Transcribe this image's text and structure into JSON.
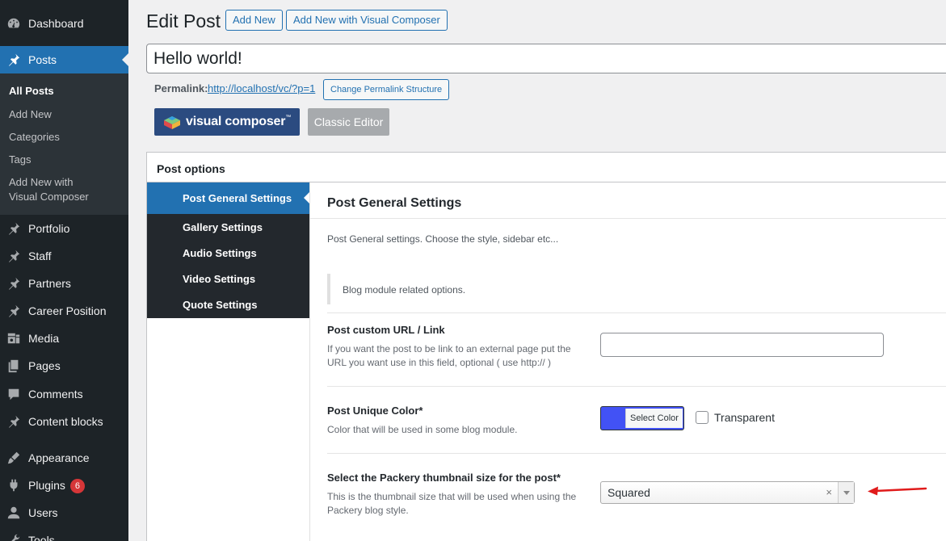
{
  "sidebar": {
    "items": [
      {
        "label": "Dashboard",
        "icon": "dashboard-icon"
      },
      {
        "label": "Posts",
        "icon": "pushpin-icon"
      },
      {
        "label": "Portfolio",
        "icon": "pushpin-icon"
      },
      {
        "label": "Staff",
        "icon": "pushpin-icon"
      },
      {
        "label": "Partners",
        "icon": "pushpin-icon"
      },
      {
        "label": "Career Position",
        "icon": "pushpin-icon"
      },
      {
        "label": "Media",
        "icon": "media-icon"
      },
      {
        "label": "Pages",
        "icon": "pages-icon"
      },
      {
        "label": "Comments",
        "icon": "comments-icon"
      },
      {
        "label": "Content blocks",
        "icon": "pushpin-icon"
      },
      {
        "label": "Appearance",
        "icon": "appearance-icon"
      },
      {
        "label": "Plugins",
        "icon": "plugins-icon",
        "badge": "6"
      },
      {
        "label": "Users",
        "icon": "users-icon"
      },
      {
        "label": "Tools",
        "icon": "tools-icon"
      }
    ],
    "posts_submenu": [
      "All Posts",
      "Add New",
      "Categories",
      "Tags",
      "Add New with\nVisual Composer"
    ],
    "current_item": "Posts",
    "current_subitem": "All Posts"
  },
  "header": {
    "title": "Edit Post",
    "add_new_label": "Add New",
    "add_new_vc_label": "Add New with Visual Composer"
  },
  "post": {
    "title": "Hello world!"
  },
  "permalink": {
    "label": "Permalink:",
    "url": "http://localhost/vc/?p=1",
    "change_button": "Change Permalink Structure"
  },
  "editor_switch": {
    "vc_label": "visual composer",
    "vc_tm": "™",
    "classic_label": "Classic Editor"
  },
  "post_options": {
    "title": "Post options",
    "tabs": [
      "Post General Settings",
      "Gallery Settings",
      "Audio Settings",
      "Video Settings",
      "Quote Settings"
    ],
    "active_tab": "Post General Settings",
    "panel": {
      "title": "Post General Settings",
      "description": "Post General settings. Choose the style, sidebar etc...",
      "notice": "Blog module related options.",
      "fields": {
        "custom_url": {
          "label": "Post custom URL / Link",
          "description": "If you want the post to be link to an external page put the URL you want use in this field, optional ( use http:// )",
          "value": ""
        },
        "unique_color": {
          "label": "Post Unique Color*",
          "description": "Color that will be used in some blog module.",
          "button_label": "Select Color",
          "swatch_color": "#4252f5",
          "transparent_label": "Transparent",
          "transparent_checked": false
        },
        "packery_size": {
          "label": "Select the Packery thumbnail size for the post*",
          "description": "This is the thumbnail size that will be used when using the Packery blog style.",
          "selected": "Squared",
          "clear_glyph": "×"
        }
      }
    }
  },
  "colors": {
    "sidebar_bg": "#1d2327",
    "accent": "#2271b1",
    "vc_brand": "#2b4b80",
    "badge": "#d63638",
    "annotation_arrow": "#e01b1b"
  }
}
